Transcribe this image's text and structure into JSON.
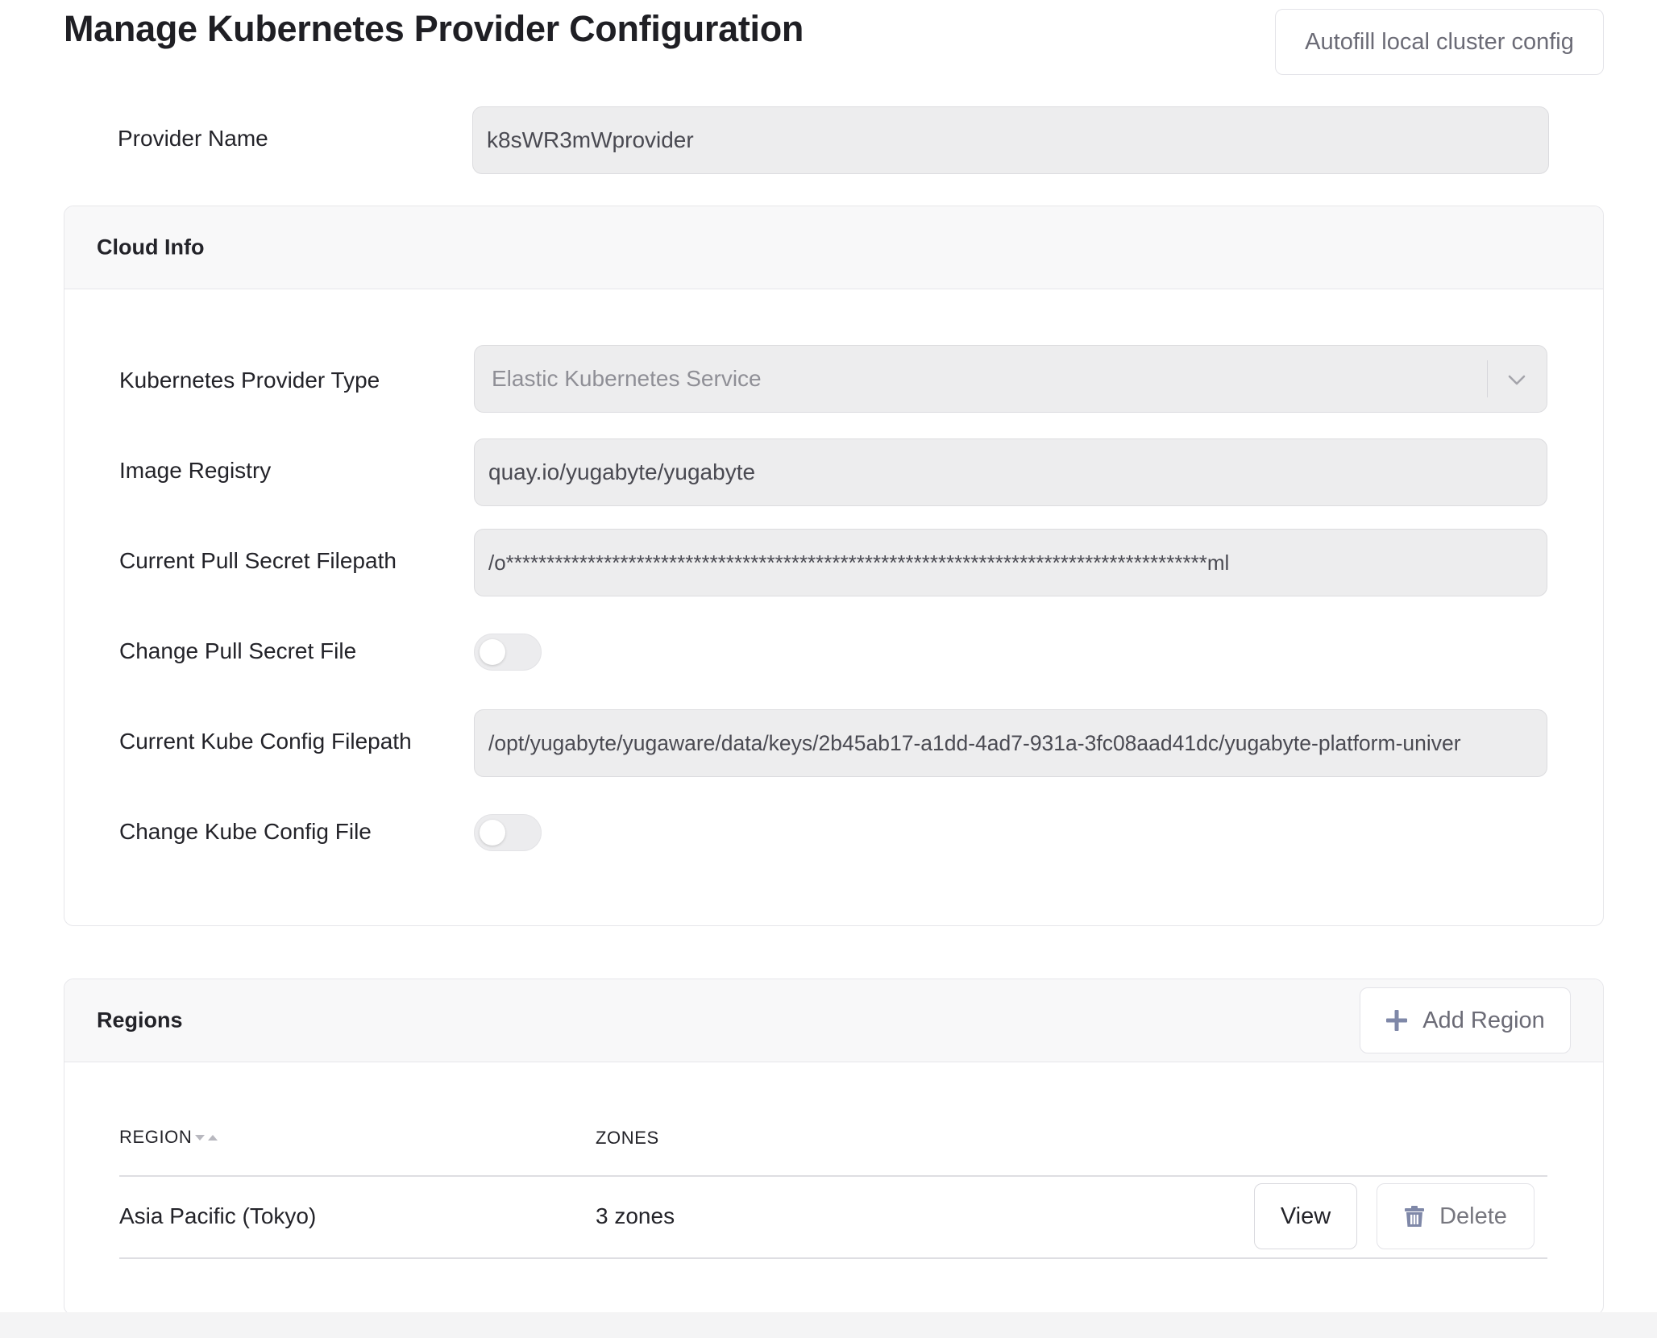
{
  "page": {
    "title": "Manage Kubernetes Provider Configuration",
    "autofill_button": "Autofill local cluster config"
  },
  "provider_name": {
    "label": "Provider Name",
    "value": "k8sWR3mWprovider"
  },
  "cloud_info": {
    "title": "Cloud Info",
    "provider_type": {
      "label": "Kubernetes Provider Type",
      "value": "Elastic Kubernetes Service",
      "icon": "chevron-down-icon"
    },
    "image_registry": {
      "label": "Image Registry",
      "value": "quay.io/yugabyte/yugabyte"
    },
    "pull_secret_filepath": {
      "label": "Current Pull Secret Filepath",
      "value": "/o**************************************************************************************ml"
    },
    "change_pull_secret": {
      "label": "Change Pull Secret File",
      "enabled": false
    },
    "kube_config_filepath": {
      "label": "Current Kube Config Filepath",
      "value": "/opt/yugabyte/yugaware/data/keys/2b45ab17-a1dd-4ad7-931a-3fc08aad41dc/yugabyte-platform-univer"
    },
    "change_kube_config": {
      "label": "Change Kube Config File",
      "enabled": false
    }
  },
  "regions": {
    "title": "Regions",
    "add_button": "Add Region",
    "add_icon": "plus-icon",
    "columns": [
      "REGION",
      "ZONES"
    ],
    "sort_icon": "sort-icon",
    "rows": [
      {
        "region": "Asia Pacific (Tokyo)",
        "zones": "3 zones",
        "view_label": "View",
        "delete_label": "Delete",
        "delete_icon": "trash-icon"
      }
    ]
  },
  "colors": {
    "input_bg": "#ededee",
    "panel_header_bg": "#f8f8f9",
    "border": "#e6e6ea",
    "icon_accent": "#7f88a8"
  }
}
